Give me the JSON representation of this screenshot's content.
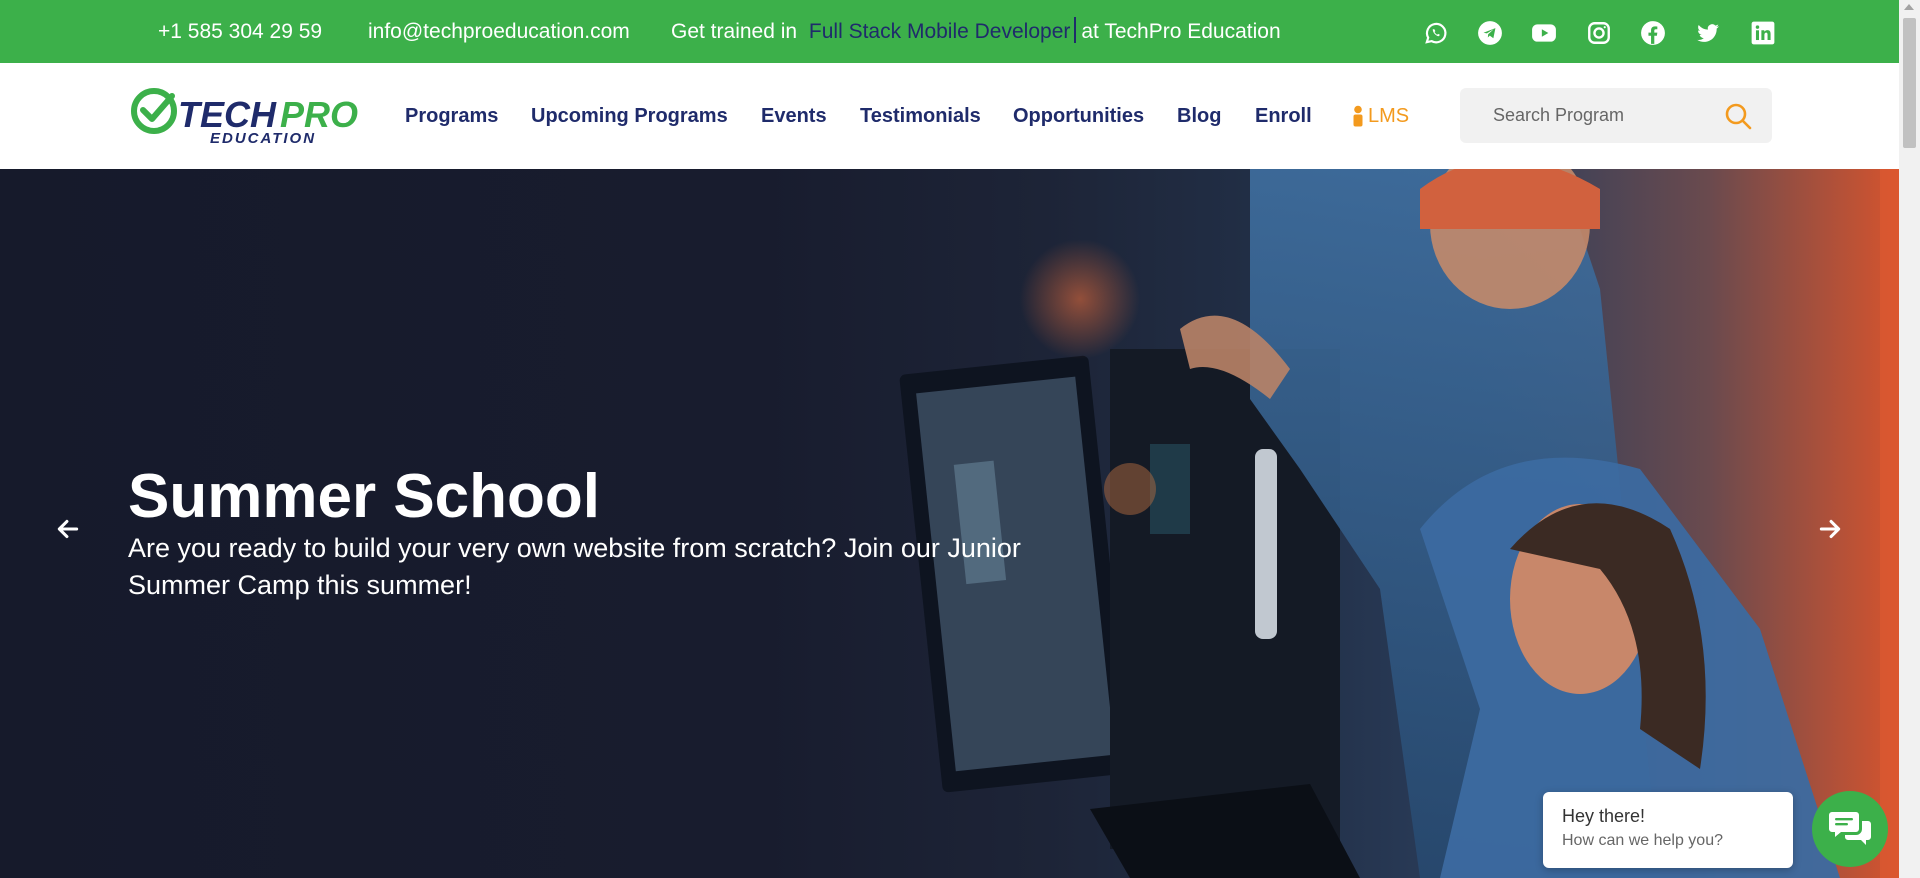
{
  "topbar": {
    "phone": "+1 585 304 29 59",
    "email": "info@techproeducation.com",
    "trained_prefix": "Get trained in",
    "trained_course": "Full Stack Mobile Developer",
    "trained_suffix": "at TechPro Education",
    "social_icons": [
      "whatsapp-icon",
      "telegram-icon",
      "youtube-icon",
      "instagram-icon",
      "facebook-icon",
      "twitter-icon",
      "linkedin-icon"
    ]
  },
  "logo": {
    "main_a": "TECH",
    "main_b": "PRO",
    "sub": "EDUCATION"
  },
  "nav": {
    "items": [
      "Programs",
      "Upcoming Programs",
      "Events",
      "Testimonials",
      "Opportunities",
      "Blog",
      "Enroll"
    ],
    "lms": "LMS"
  },
  "search": {
    "placeholder": "Search Program"
  },
  "hero": {
    "title": "Summer School",
    "subtitle": "Are you ready to build your very own website from scratch? Join our Junior Summer Camp this summer!"
  },
  "chat": {
    "heading": "Hey there!",
    "subtext": "How can we help you?"
  },
  "colors": {
    "brand_green": "#3cb04a",
    "navy": "#1f2b6b",
    "accent_orange": "#f39a1e"
  }
}
